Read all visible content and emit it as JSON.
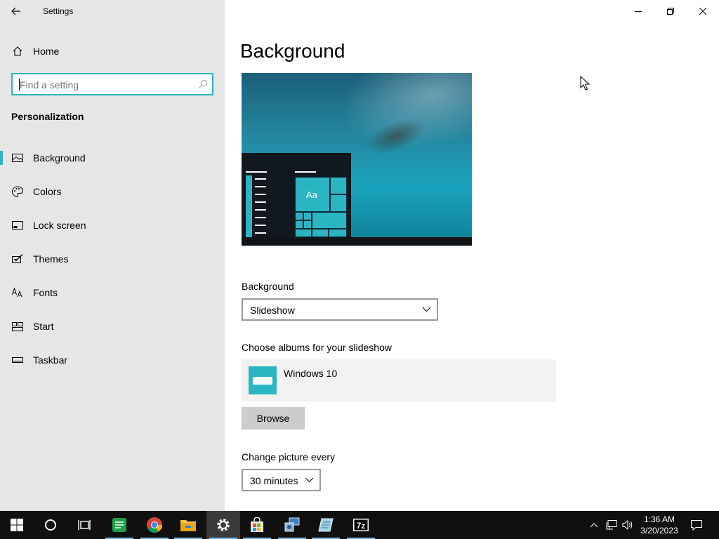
{
  "window": {
    "title": "Settings"
  },
  "sidebar": {
    "home_label": "Home",
    "search_placeholder": "Find a setting",
    "section_title": "Personalization",
    "items": [
      {
        "label": "Background",
        "icon": "picture-icon",
        "active": true
      },
      {
        "label": "Colors",
        "icon": "palette-icon"
      },
      {
        "label": "Lock screen",
        "icon": "lock-screen-icon"
      },
      {
        "label": "Themes",
        "icon": "themes-icon"
      },
      {
        "label": "Fonts",
        "icon": "fonts-icon"
      },
      {
        "label": "Start",
        "icon": "start-icon"
      },
      {
        "label": "Taskbar",
        "icon": "taskbar-icon"
      }
    ]
  },
  "main": {
    "title": "Background",
    "preview_tile_text": "Aa",
    "background_label": "Background",
    "background_value": "Slideshow",
    "albums_label": "Choose albums for your slideshow",
    "album_name": "Windows 10",
    "browse_label": "Browse",
    "change_label": "Change picture every",
    "change_value": "30 minutes"
  },
  "taskbar": {
    "apps": [
      "start-icon",
      "cortana-icon",
      "task-view-icon",
      "spreadsheet-icon",
      "chrome-icon",
      "file-explorer-icon",
      "settings-icon",
      "store-icon",
      "control-panel-icon",
      "notepad-icon",
      "7zip-icon"
    ],
    "running": [
      "spreadsheet-icon",
      "chrome-icon",
      "file-explorer-icon",
      "settings-icon",
      "store-icon",
      "control-panel-icon",
      "notepad-icon",
      "7zip-icon"
    ],
    "sevenzip_text": "7z",
    "time": "1:36 AM",
    "date": "3/20/2023"
  },
  "colors": {
    "accent": "#2bb5c3",
    "sidebar_bg": "#e6e6e6",
    "taskbar_bg": "#101010"
  }
}
